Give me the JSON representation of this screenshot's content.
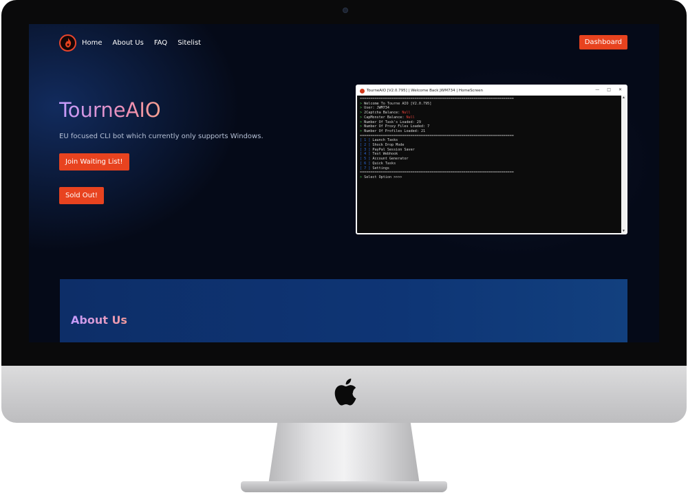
{
  "nav": {
    "items": [
      {
        "label": "Home"
      },
      {
        "label": "About Us"
      },
      {
        "label": "FAQ"
      },
      {
        "label": "Sitelist"
      }
    ],
    "dashboard_label": "Dashboard"
  },
  "hero": {
    "title": "TourneAIO",
    "subtitle": "EU focused CLI bot which currently only supports Windows.",
    "waitlist_label": "Join Waiting List!",
    "soldout_label": "Sold Out!"
  },
  "terminal": {
    "window_title": "TourneAIO [V2.0.795] | Welcome Back JWM734 | HomeScreen",
    "separator": "=========================================================================",
    "status_lines": [
      {
        "label": "Welcome To Tourne AIO [V2.0.795]",
        "value": ""
      },
      {
        "label": "User: JWM734",
        "value": ""
      },
      {
        "label": "2Captcha Balance: ",
        "value": "Null"
      },
      {
        "label": "CapMonster Balance: ",
        "value": "Null"
      },
      {
        "label": "Number Of Task's Loaded: 29",
        "value": ""
      },
      {
        "label": "Number Of Proxy Files Loaded: 7",
        "value": ""
      },
      {
        "label": "Number Of Profiles Loaded: 21",
        "value": ""
      }
    ],
    "menu": [
      {
        "num": "1",
        "label": "Launch Tasks"
      },
      {
        "num": "2",
        "label": "Shock Drop Mode"
      },
      {
        "num": "3",
        "label": "PayPal Session Saver"
      },
      {
        "num": "4",
        "label": "Test Webhook"
      },
      {
        "num": "5",
        "label": "Account Generator"
      },
      {
        "num": "6",
        "label": "Quick Tasks"
      },
      {
        "num": "7",
        "label": "Settings"
      }
    ],
    "prompt": "Select Option >>>>"
  },
  "about": {
    "title": "About Us"
  },
  "colors": {
    "accent": "#e8431f",
    "background": "#050a18",
    "section": "#0e3575"
  },
  "icons": {
    "logo": "flame-icon",
    "apple": "apple-logo-icon"
  }
}
